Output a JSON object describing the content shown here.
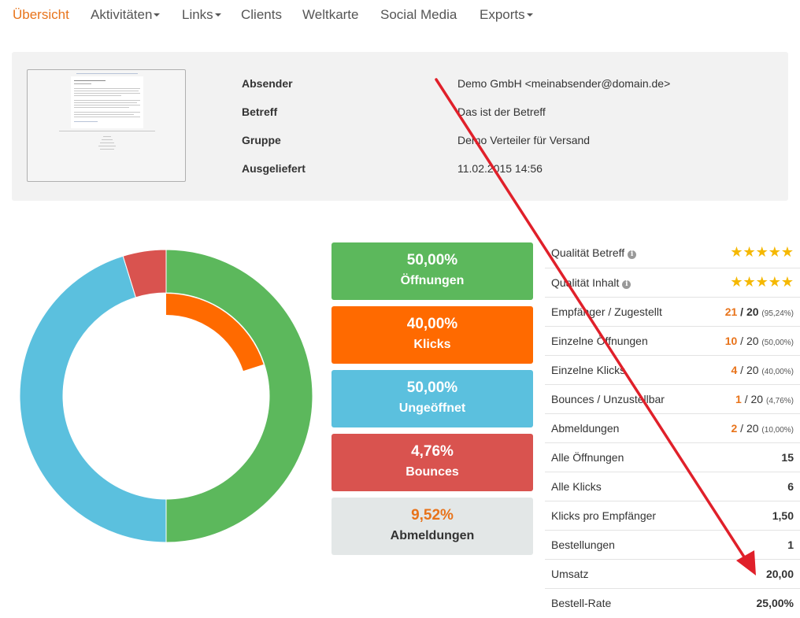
{
  "nav": {
    "items": [
      {
        "label": "Übersicht",
        "active": true,
        "dropdown": false
      },
      {
        "label": "Aktivitäten",
        "active": false,
        "dropdown": true
      },
      {
        "label": "Links",
        "active": false,
        "dropdown": true
      },
      {
        "label": "Clients",
        "active": false,
        "dropdown": false
      },
      {
        "label": "Weltkarte",
        "active": false,
        "dropdown": false
      },
      {
        "label": "Social Media",
        "active": false,
        "dropdown": false
      },
      {
        "label": "Exports",
        "active": false,
        "dropdown": true
      }
    ]
  },
  "mailing": {
    "details": [
      {
        "label": "Absender",
        "value": "Demo GmbH <meinabsender@domain.de>"
      },
      {
        "label": "Betreff",
        "value": "Das ist der Betreff"
      },
      {
        "label": "Gruppe",
        "value": "Demo Verteiler für Versand"
      },
      {
        "label": "Ausgeliefert",
        "value": "11.02.2015 14:56"
      }
    ]
  },
  "stats": [
    {
      "value": "50,00%",
      "label": "Öffnungen",
      "color": "#5cb85c",
      "text_color": "#ffffff"
    },
    {
      "value": "40,00%",
      "label": "Klicks",
      "color": "#ff6a00",
      "text_color": "#ffffff"
    },
    {
      "value": "50,00%",
      "label": "Ungeöffnet",
      "color": "#5bc0de",
      "text_color": "#ffffff"
    },
    {
      "value": "4,76%",
      "label": "Bounces",
      "color": "#d9534f",
      "text_color": "#ffffff"
    },
    {
      "value": "9,52%",
      "label": "Abmeldungen",
      "color": "#e3e7e7",
      "text_color": "#e8731a",
      "label_color": "#333333"
    }
  ],
  "chart_data": {
    "type": "pie",
    "variant": "donut",
    "outer_ring": [
      {
        "label": "Öffnungen",
        "value": 50.0,
        "color": "#5cb85c"
      },
      {
        "label": "Ungeöffnet",
        "value": 45.24,
        "color": "#5bc0de"
      },
      {
        "label": "Bounces",
        "value": 4.76,
        "color": "#d9534f"
      }
    ],
    "inner_ring": [
      {
        "label": "Klicks",
        "value": 40.0,
        "color": "#ff6a00",
        "share_of_full_circle": 0.2
      }
    ]
  },
  "metrics": [
    {
      "label": "Qualität Betreff",
      "info": true,
      "stars": "★★★★★"
    },
    {
      "label": "Qualität Inhalt",
      "info": true,
      "stars": "★★★★★"
    },
    {
      "label": "Empfänger / Zugestellt",
      "count": "21",
      "total": "/ 20",
      "pct": "(95,24%)"
    },
    {
      "label": "Einzelne Öffnungen",
      "count": "10",
      "total": "/ 20",
      "pct": "(50,00%)"
    },
    {
      "label": "Einzelne Klicks",
      "count": "4",
      "total": "/ 20",
      "pct": "(40,00%)"
    },
    {
      "label": "Bounces / Unzustellbar",
      "count": "1",
      "total": "/ 20",
      "pct": "(4,76%)"
    },
    {
      "label": "Abmeldungen",
      "count": "2",
      "total": "/ 20",
      "pct": "(10,00%)"
    },
    {
      "label": "Alle Öffnungen",
      "value": "15"
    },
    {
      "label": "Alle Klicks",
      "value": "6"
    },
    {
      "label": "Klicks pro Empfänger",
      "value": "1,50"
    },
    {
      "label": "Bestellungen",
      "value": "1"
    },
    {
      "label": "Umsatz",
      "value": "20,00"
    },
    {
      "label": "Bestell-Rate",
      "value": "25,00%"
    }
  ],
  "colors": {
    "accent": "#e8731a",
    "annotation_arrow": "#e0202a"
  }
}
